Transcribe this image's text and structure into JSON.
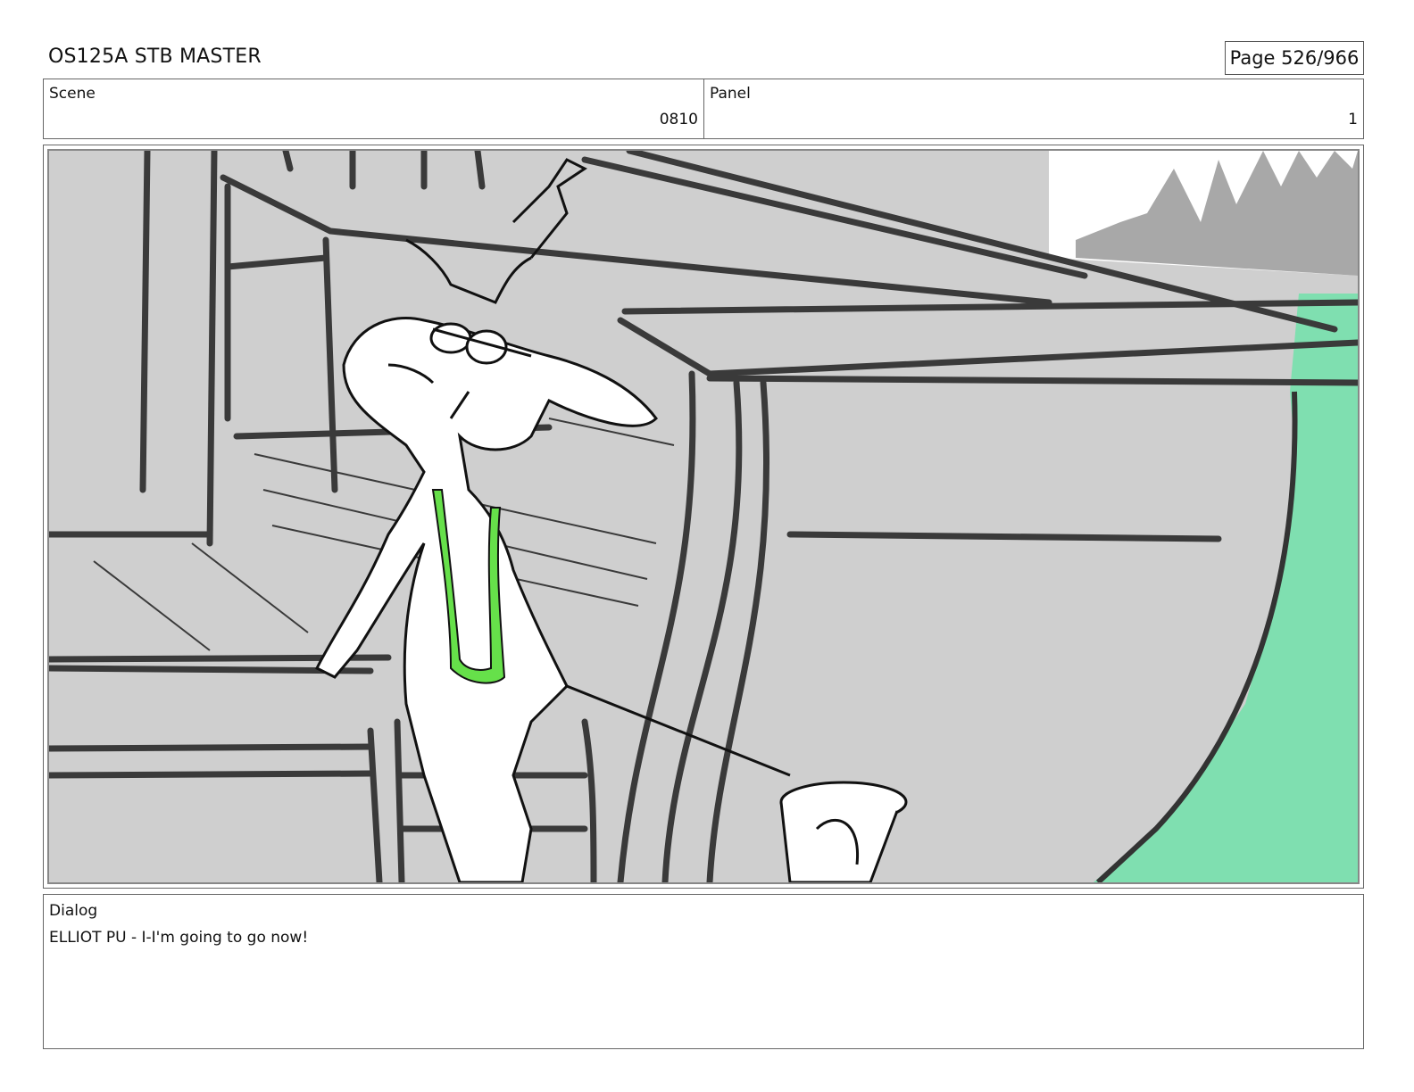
{
  "header": {
    "title": "OS125A STB MASTER",
    "page": "Page 526/966"
  },
  "scene": {
    "label": "Scene",
    "value": "0810"
  },
  "panel": {
    "label": "Panel",
    "value": "1"
  },
  "dialog": {
    "label": "Dialog",
    "text": "ELLIOT PU - I-I'm going to go now!"
  },
  "colors": {
    "water": "#7fdfb0",
    "swimsuit": "#66e04a",
    "concrete": "#cfcfcf",
    "trees": "#a8a8a8"
  }
}
